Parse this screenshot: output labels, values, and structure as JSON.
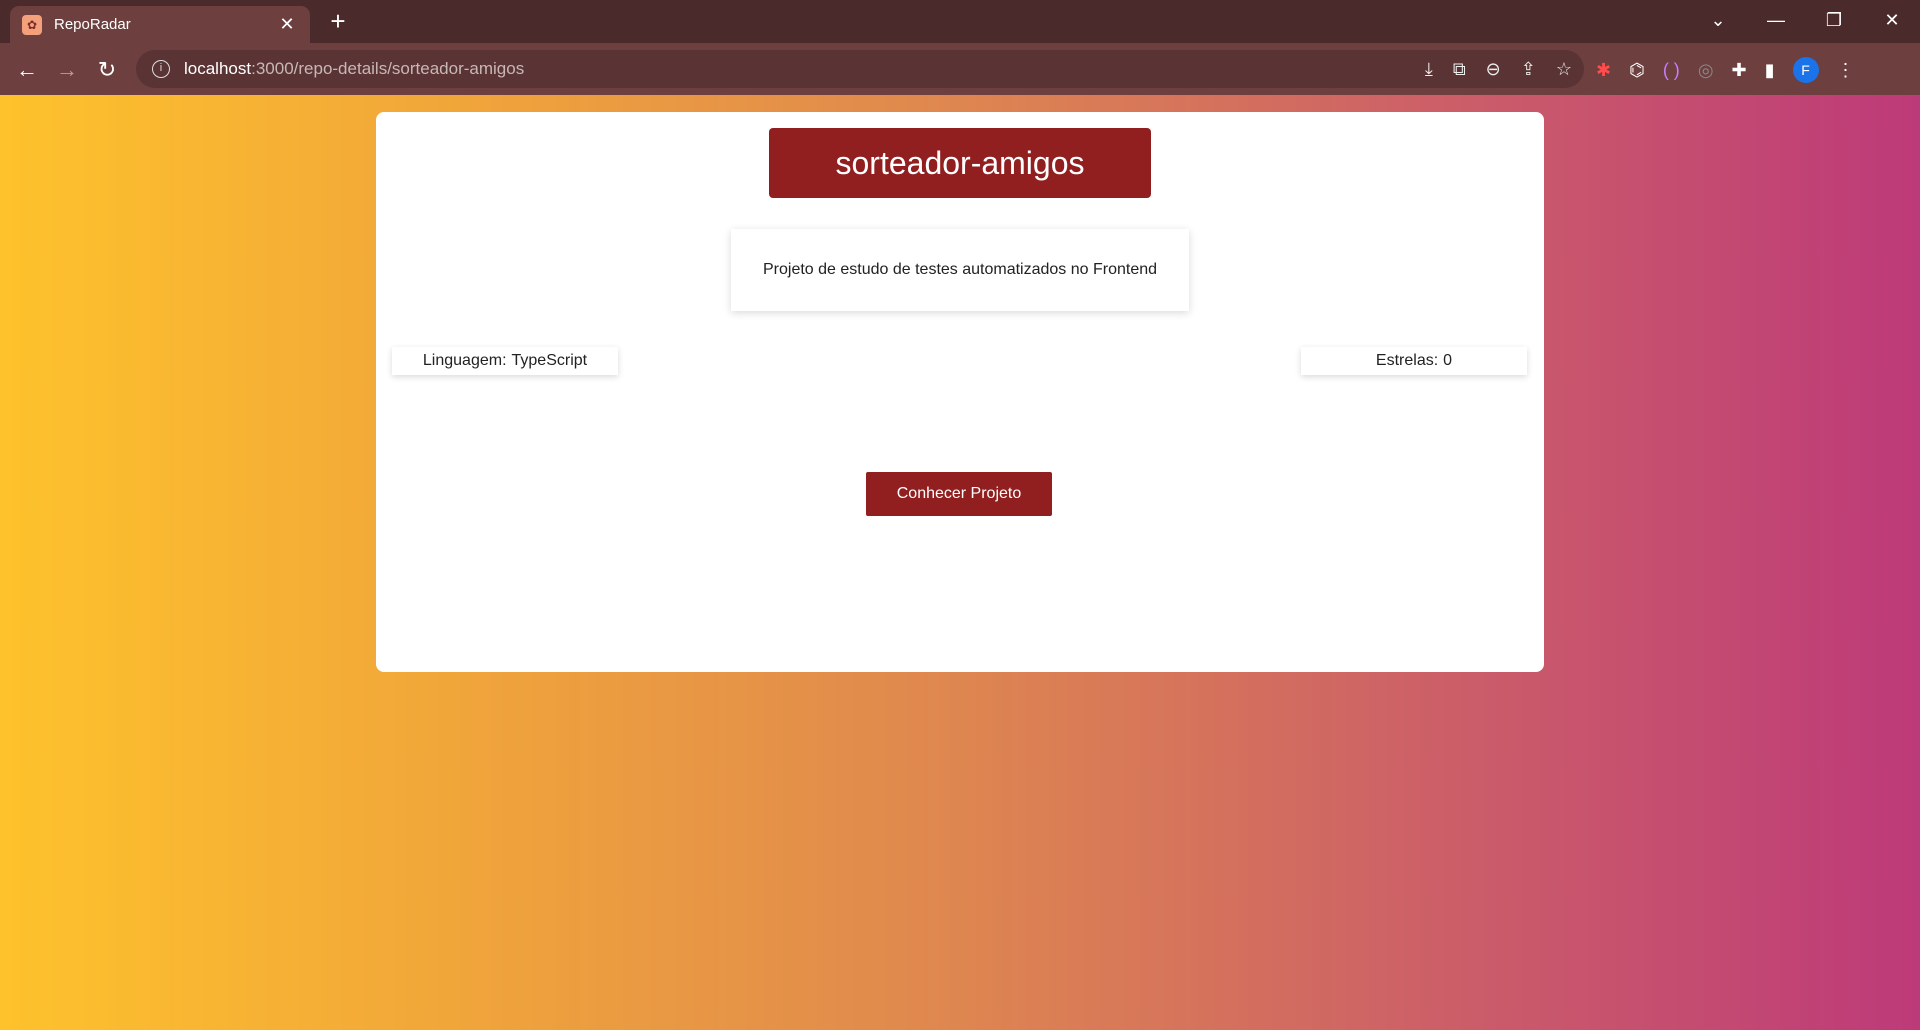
{
  "browser": {
    "tab_title": "RepoRadar",
    "tab_close": "✕",
    "new_tab": "+",
    "url_host": "localhost",
    "url_path": ":3000/repo-details/sorteador-amigos",
    "profile_initial": "F"
  },
  "repo": {
    "name": "sorteador-amigos",
    "description": "Projeto de estudo de testes automatizados no Frontend",
    "language_label": "Linguagem:",
    "language_value": "TypeScript",
    "stars_label": "Estrelas:",
    "stars_value": "0",
    "cta_label": "Conhecer Projeto"
  },
  "colors": {
    "accent": "#911f20",
    "gradient_start": "#fec22c",
    "gradient_end": "#bd3a79"
  }
}
